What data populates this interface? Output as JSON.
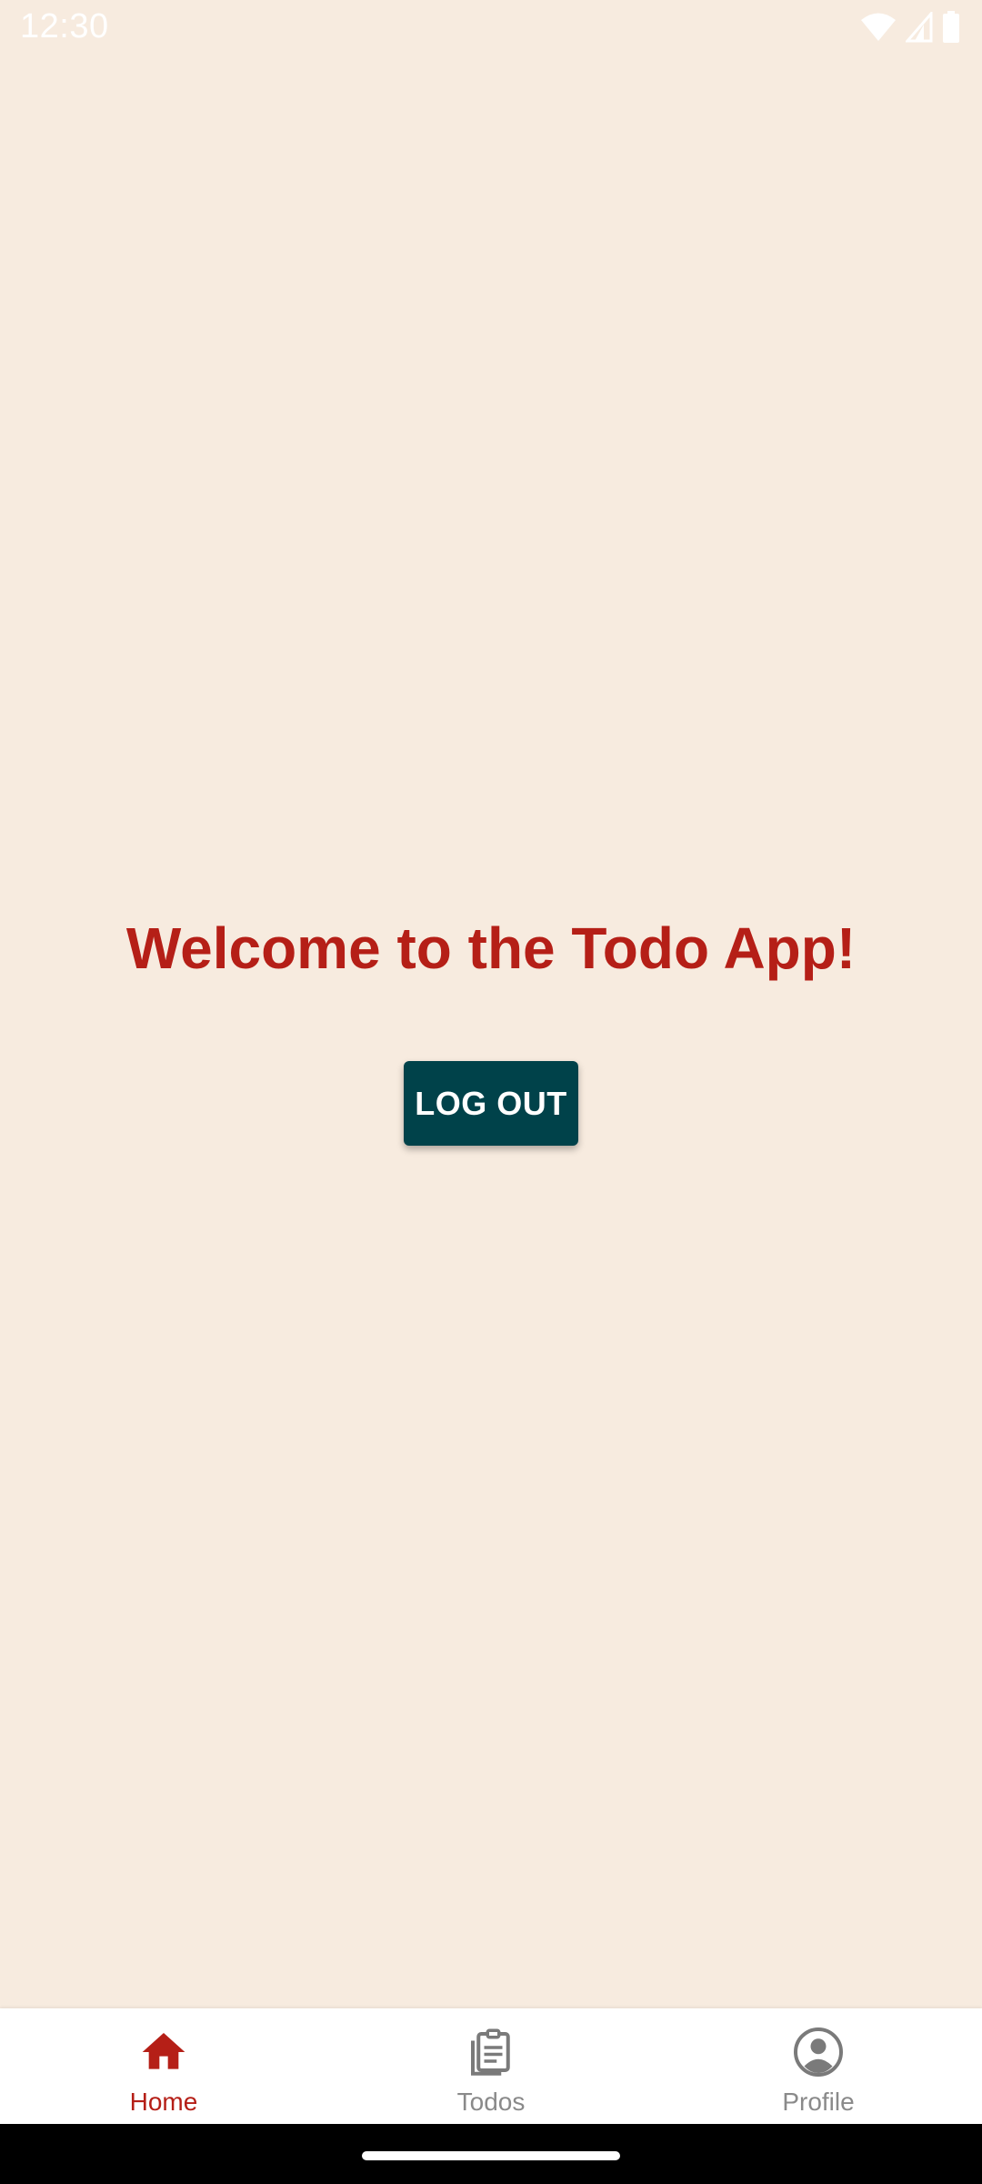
{
  "status_bar": {
    "time": "12:30",
    "icons": [
      "wifi-icon",
      "signal-icon",
      "battery-icon"
    ]
  },
  "main": {
    "title": "Welcome to the Todo App!",
    "logout_label": "LOG OUT"
  },
  "bottom_nav": {
    "items": [
      {
        "label": "Home",
        "icon": "home-icon",
        "active": true
      },
      {
        "label": "Todos",
        "icon": "clipboard-icon",
        "active": false
      },
      {
        "label": "Profile",
        "icon": "account-circle-icon",
        "active": false
      }
    ]
  },
  "colors": {
    "background": "#f7ebdf",
    "accent": "#b51f17",
    "button": "#00424a",
    "nav_inactive": "#8a8a8a"
  }
}
